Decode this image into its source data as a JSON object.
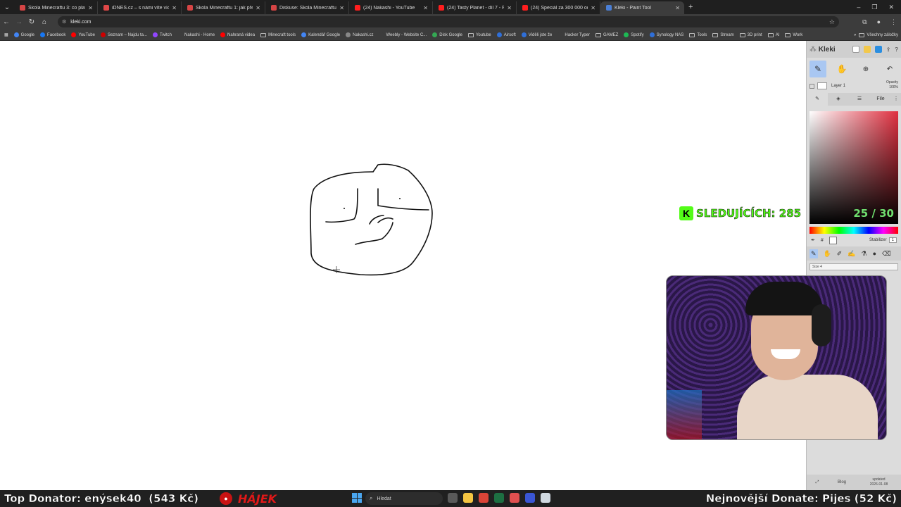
{
  "browser": {
    "tabs": [
      {
        "title": "Škola Minecraftu 3: co platí na",
        "icon": "minecraft-favicon-icon",
        "color": "#d64545"
      },
      {
        "title": "iDNES.cz – s námi víte víc",
        "icon": "idnes-favicon-icon",
        "color": "#e04848"
      },
      {
        "title": "Škola Minecraftu 1: jak přežít p",
        "icon": "minecraft-favicon-icon",
        "color": "#d64545"
      },
      {
        "title": "Diskuse: Škola Minecraftu 1: ja",
        "icon": "minecraft-favicon-icon",
        "color": "#d64545"
      },
      {
        "title": "(24) Nakashi - YouTube",
        "icon": "youtube-icon",
        "color": "#ff1e1e"
      },
      {
        "title": "(24) Tasty Planet - díl 7 - Finál",
        "icon": "youtube-icon",
        "color": "#ff1e1e"
      },
      {
        "title": "(24) Speciál za 300 000 odběr",
        "icon": "youtube-icon",
        "color": "#ff1e1e"
      },
      {
        "title": "Kleki - Paint Tool",
        "icon": "kleki-favicon-icon",
        "color": "#4a7fd6",
        "active": true
      }
    ],
    "url": "kleki.com",
    "bookmarks": [
      {
        "label": "Google",
        "color": "#4285f4",
        "type": "site"
      },
      {
        "label": "Facebook",
        "color": "#1877f2",
        "type": "site"
      },
      {
        "label": "YouTube",
        "color": "#ff0000",
        "type": "site"
      },
      {
        "label": "Seznam – Najdu ta...",
        "color": "#cc0000",
        "type": "site"
      },
      {
        "label": "Twitch",
        "color": "#9146ff",
        "type": "site"
      },
      {
        "label": "Nakashi - Home",
        "color": "#3c3c3c",
        "type": "site"
      },
      {
        "label": "Nahraná videa",
        "color": "#ff0000",
        "type": "site"
      },
      {
        "label": "Minecraft tools",
        "color": "",
        "type": "folder"
      },
      {
        "label": "Kalendář Google",
        "color": "#4285f4",
        "type": "site"
      },
      {
        "label": "Nakashi.cz",
        "color": "#888888",
        "type": "site"
      },
      {
        "label": "Weebly - Website C...",
        "color": "#3c3c3c",
        "type": "site"
      },
      {
        "label": "Disk Google",
        "color": "#34a853",
        "type": "site"
      },
      {
        "label": "Youtube",
        "color": "",
        "type": "folder"
      },
      {
        "label": "Airsoft",
        "color": "#2f6fd8",
        "type": "site"
      },
      {
        "label": "Viděli jste že",
        "color": "#2f6fd8",
        "type": "site"
      },
      {
        "label": "Hacker Typer",
        "color": "#3c3c3c",
        "type": "site"
      },
      {
        "label": "GAMEZ",
        "color": "",
        "type": "folder"
      },
      {
        "label": "Spotify",
        "color": "#1db954",
        "type": "site"
      },
      {
        "label": "Synology NAS",
        "color": "#2f6fd8",
        "type": "site"
      },
      {
        "label": "Tools",
        "color": "",
        "type": "folder"
      },
      {
        "label": "Stream",
        "color": "",
        "type": "folder"
      },
      {
        "label": "3D print",
        "color": "",
        "type": "folder"
      },
      {
        "label": "AI",
        "color": "",
        "type": "folder"
      },
      {
        "label": "Work",
        "color": "",
        "type": "folder"
      }
    ],
    "bookmarks_overflow": "»",
    "all_bookmarks": "Všechny záložky"
  },
  "kleki": {
    "logo": "Kleki",
    "layer_name": "Layer 1",
    "opacity_label": "Opacity",
    "opacity_value": "100%",
    "tabs": [
      "",
      "",
      "",
      "File"
    ],
    "stabilizer_label": "Stabilizer",
    "stabilizer_value": "1",
    "size_label": "Size  4",
    "footer_blog": "Blog",
    "footer_updated": "updated",
    "footer_date": "2026-01-08"
  },
  "overlay": {
    "followers_text": "SLEDUJÍCÍCH: 285",
    "counter": "25 / 30",
    "top_donator": "Top Donator: enýsek40  (543 Kč)",
    "sponsor_name": "HÁJEK",
    "latest_donate": "Nejnovější Donate: Pijes (52 Kč)",
    "kick_color": "#53fc18"
  },
  "taskbar": {
    "search_placeholder": "Hledat",
    "apps": [
      {
        "icon": "task-view-icon",
        "color": "#5a5a5a"
      },
      {
        "icon": "file-explorer-icon",
        "color": "#f4c542"
      },
      {
        "icon": "chrome-icon",
        "color": "#db4437"
      },
      {
        "icon": "excel-icon",
        "color": "#1d6f42"
      },
      {
        "icon": "settings-icon",
        "color": "#e05050"
      },
      {
        "icon": "game-launcher-icon",
        "color": "#3a56d4"
      },
      {
        "icon": "steam-icon",
        "color": "#d0d8e0"
      }
    ]
  }
}
